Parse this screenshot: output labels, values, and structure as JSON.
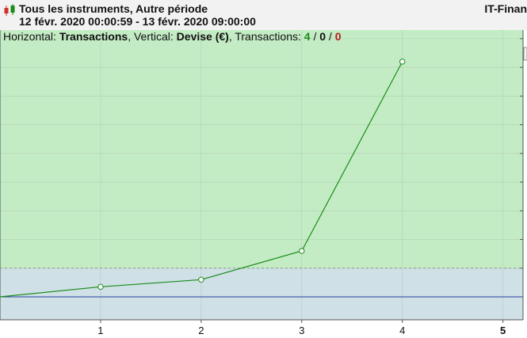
{
  "header": {
    "title": "Tous les instruments, Autre période",
    "date_range": "12 févr. 2020 00:00:59 - 13 févr. 2020 09:00:00",
    "brand": "IT-Finan",
    "icon": "candlestick-icon"
  },
  "infobar": {
    "horizontal_label": "Horizontal:",
    "horizontal_value": "Transactions",
    "vertical_label": ", Vertical:",
    "vertical_value": "Devise (€)",
    "transactions_label": ", Transactions:",
    "count_green": "4",
    "sep1": " / ",
    "count_neutral": "0",
    "sep2": " / ",
    "count_red": "0"
  },
  "colors": {
    "profit_zone": "#c4ecc4",
    "loss_zone": "#cfe0e6",
    "line": "#1a8c1a",
    "baseline": "#2b3f9e",
    "candle_green": "#1a8c1a",
    "candle_red": "#d03030"
  },
  "chart_data": {
    "type": "line",
    "x": [
      0,
      1,
      2,
      3,
      4
    ],
    "y": [
      0,
      0.35,
      0.6,
      1.6,
      8.2
    ],
    "xlim": [
      0,
      5.2
    ],
    "ylim": [
      -0.8,
      9.3
    ],
    "baseline": 0,
    "zone_threshold": 1.0,
    "x_ticks": [
      "1",
      "2",
      "3",
      "4",
      "5"
    ],
    "highlighted_tick": "5",
    "grid": true,
    "title": "",
    "xlabel": "",
    "ylabel": ""
  }
}
